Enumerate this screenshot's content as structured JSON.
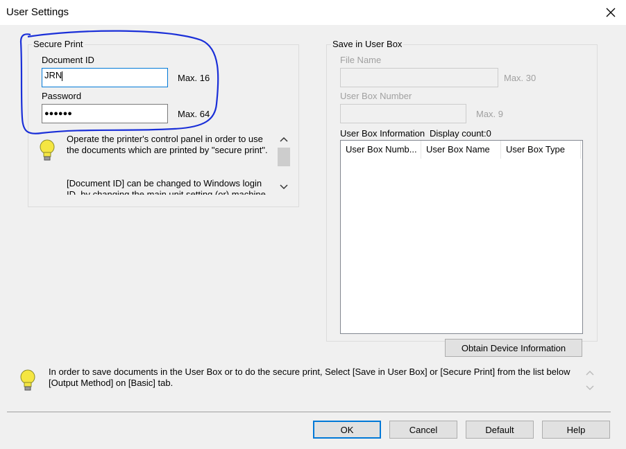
{
  "window": {
    "title": "User Settings"
  },
  "secure_print": {
    "legend": "Secure Print",
    "document_id_label": "Document ID",
    "document_id_value": "JRN",
    "document_id_max": "Max. 16",
    "password_label": "Password",
    "password_value": "●●●●●●",
    "password_max": "Max. 64",
    "info_line1": "Operate the printer's control panel in order to use",
    "info_line2": "the documents which are printed by \"secure print\".",
    "info_line3": "[Document ID] can be changed to Windows login",
    "info_line4": "ID, by changing the main unit setting (or) machine"
  },
  "user_box": {
    "legend": "Save in User Box",
    "file_name_label": "File Name",
    "file_name_value": "",
    "file_name_max": "Max. 30",
    "box_number_label": "User Box Number",
    "box_number_value": "",
    "box_number_max": "Max. 9",
    "info_label": "User Box Information",
    "display_count": "Display count:0",
    "columns": [
      "User Box Numb...",
      "User Box Name",
      "User Box Type"
    ],
    "obtain_button": "Obtain Device Information"
  },
  "footer": {
    "message_line1": "In order to save documents in the User Box or to do the secure print, Select [Save in User Box] or [Secure Print] from the list below",
    "message_line2": "[Output Method] on [Basic] tab."
  },
  "buttons": {
    "ok": "OK",
    "cancel": "Cancel",
    "default": "Default",
    "help": "Help"
  },
  "icons": {
    "bulb": "lightbulb-icon",
    "close": "close-icon"
  },
  "colors": {
    "focus_border": "#0078d7",
    "annotation": "#1a2fd8",
    "bulb": "#f5e642"
  }
}
